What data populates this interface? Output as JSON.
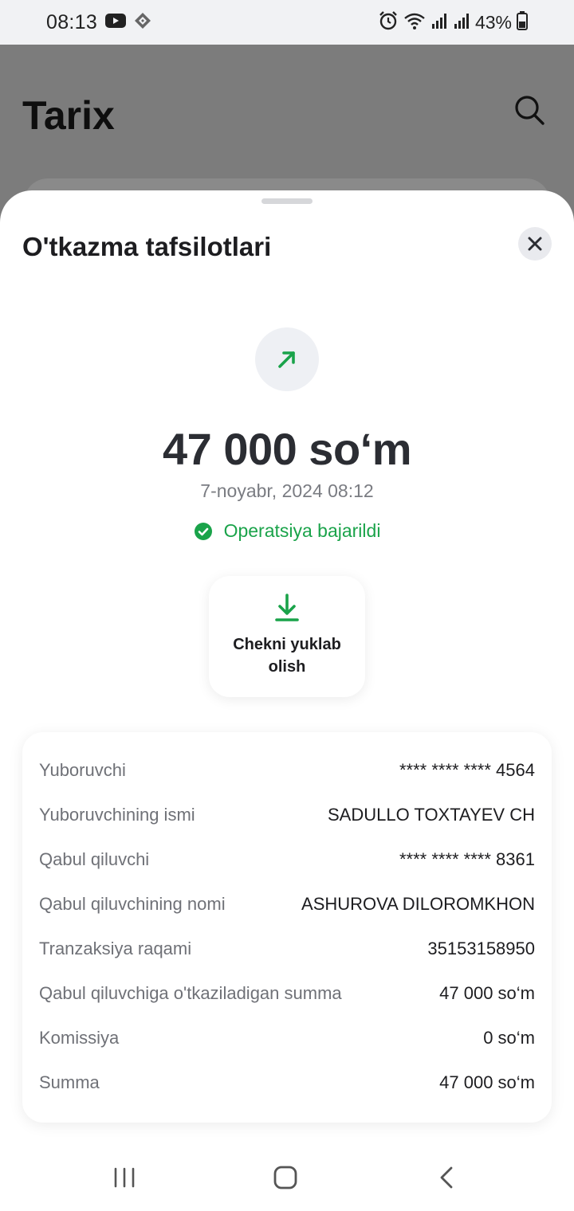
{
  "status_bar": {
    "time": "08:13",
    "battery_percent": "43%",
    "icons": [
      "youtube-icon",
      "app-icon",
      "alarm-icon",
      "wifi-icon",
      "signal-icon",
      "signal-icon",
      "battery-icon"
    ]
  },
  "background_screen": {
    "title": "Tarix"
  },
  "sheet": {
    "title": "O'tkazma tafsilotlari",
    "direction_icon": "arrow-up-right-icon",
    "amount": "47 000 so‘m",
    "datetime": "7-noyabr, 2024 08:12",
    "status": "Operatsiya bajarildi",
    "receipt_button": "Chekni yuklab olish"
  },
  "details": [
    {
      "label": "Yuboruvchi",
      "value": "**** **** **** 4564"
    },
    {
      "label": "Yuboruvchining ismi",
      "value": "SADULLO TOXTAYEV CH"
    },
    {
      "label": "Qabul qiluvchi",
      "value": "**** **** **** 8361"
    },
    {
      "label": "Qabul qiluvchining nomi",
      "value": "ASHUROVA DILOROMKHON"
    },
    {
      "label": "Tranzaksiya raqami",
      "value": "35153158950"
    },
    {
      "label": "Qabul qiluvchiga o'tkaziladigan summa",
      "value": "47 000 so‘m"
    },
    {
      "label": "Komissiya",
      "value": "0 so‘m"
    },
    {
      "label": "Summa",
      "value": "47 000 so‘m"
    }
  ],
  "colors": {
    "accent_green": "#1aa34a",
    "text_dark": "#1d1d20",
    "text_muted": "#6f7177",
    "overlay": "#7c7c7c"
  }
}
